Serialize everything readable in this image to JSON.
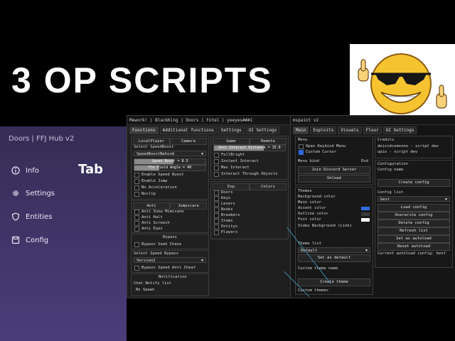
{
  "banner": {
    "title": "3 OP SCRIPTS"
  },
  "hub": {
    "header": "Doors | FFJ Hub v2",
    "tab_title": "Tab",
    "items": [
      {
        "label": "Info"
      },
      {
        "label": "Settings"
      },
      {
        "label": "Entities"
      },
      {
        "label": "Config"
      }
    ]
  },
  "win1": {
    "title": "Mework! | BlackKing | Doors | Fotel | yeeyes###1",
    "tabs": [
      "Functions",
      "Additional functions",
      "Settings",
      "UI Settings"
    ],
    "group1": {
      "tabs": [
        "LocalPlayer",
        "Camera"
      ],
      "label": "Select SpeedBoost",
      "dropdown": "SpeedBoostBehind",
      "slider1": "Speed Boost = 8.5",
      "slider2": "Fov Field Angle = 40",
      "toggles": [
        "Enable Speed Boost",
        "Enable Jump",
        "No Acceleration",
        "Noclip"
      ]
    },
    "group2": {
      "tabs": [
        "Anti",
        "Jumpscare"
      ],
      "toggles": [
        "Anti Snow Mimicane",
        "Anti Halt",
        "Anti Screech",
        "Anti Eyes"
      ]
    },
    "group3": {
      "header": "Bypass",
      "toggles": [
        "Bypass Seek Chase"
      ]
    },
    "group4": {
      "label": "Select Speed Bypass",
      "dropdown": "Version2",
      "toggles": [
        "Bypass Speed Anti Cheat"
      ]
    },
    "group5": {
      "header": "Notification",
      "label": "Chat Notify list",
      "item": "No Spawn"
    },
    "group6": {
      "tabs": [
        "Game",
        "Remote"
      ],
      "slider": "Door Interact Distance = 15.0",
      "toggles": [
        "FullBright",
        "Instant Interact",
        "Max Interact",
        "Interact Through Objects"
      ]
    },
    "group7": {
      "tabs": [
        "Esp",
        "Colors"
      ],
      "toggles": [
        "Doors",
        "Keys",
        "Levers",
        "Books",
        "Breakers",
        "Items",
        "Entitys",
        "Players"
      ]
    }
  },
  "win2": {
    "title": "mspaint v2",
    "tabs": [
      "Main",
      "Exploits",
      "Visuals",
      "Floor",
      "UI Settings"
    ],
    "menu": {
      "header": "Menu",
      "toggles": [
        {
          "label": "Open Keybind Menu",
          "on": false
        },
        {
          "label": "Custom Cursor",
          "on": true
        }
      ],
      "bind_label": "Menu bind",
      "bind_value": "End",
      "btn_discord": "Join Discord Server",
      "btn_unload": "Unload"
    },
    "themes": {
      "header": "Themes",
      "rows": [
        {
          "label": "Background color",
          "color": ""
        },
        {
          "label": "Main color",
          "color": ""
        },
        {
          "label": "Accent color",
          "color": "#2f6ae0"
        },
        {
          "label": "Outline color",
          "color": "#3a3a3a"
        },
        {
          "label": "Font color",
          "color": "#ffffff"
        }
      ],
      "video": "Video Background (Link)",
      "theme_list_label": "Theme list",
      "theme_list_value": "Default",
      "btn_default": "Set as default",
      "custom_label": "Custom theme name",
      "btn_create": "Create theme",
      "custom_themes": "Custom themes"
    },
    "credits": {
      "header": "Credits",
      "lines": [
        "deividcomsono - script dev",
        "upio - script dev"
      ]
    },
    "config": {
      "header": "Configuration",
      "name_label": "Config name",
      "btn_create": "Create config",
      "list_label": "Config list",
      "list_value": "best",
      "buttons": [
        "Load config",
        "Overwrite config",
        "Delete config",
        "Refresh list",
        "Set as autoload",
        "Reset autoload"
      ],
      "autoload": "Current autoload config: best"
    }
  }
}
